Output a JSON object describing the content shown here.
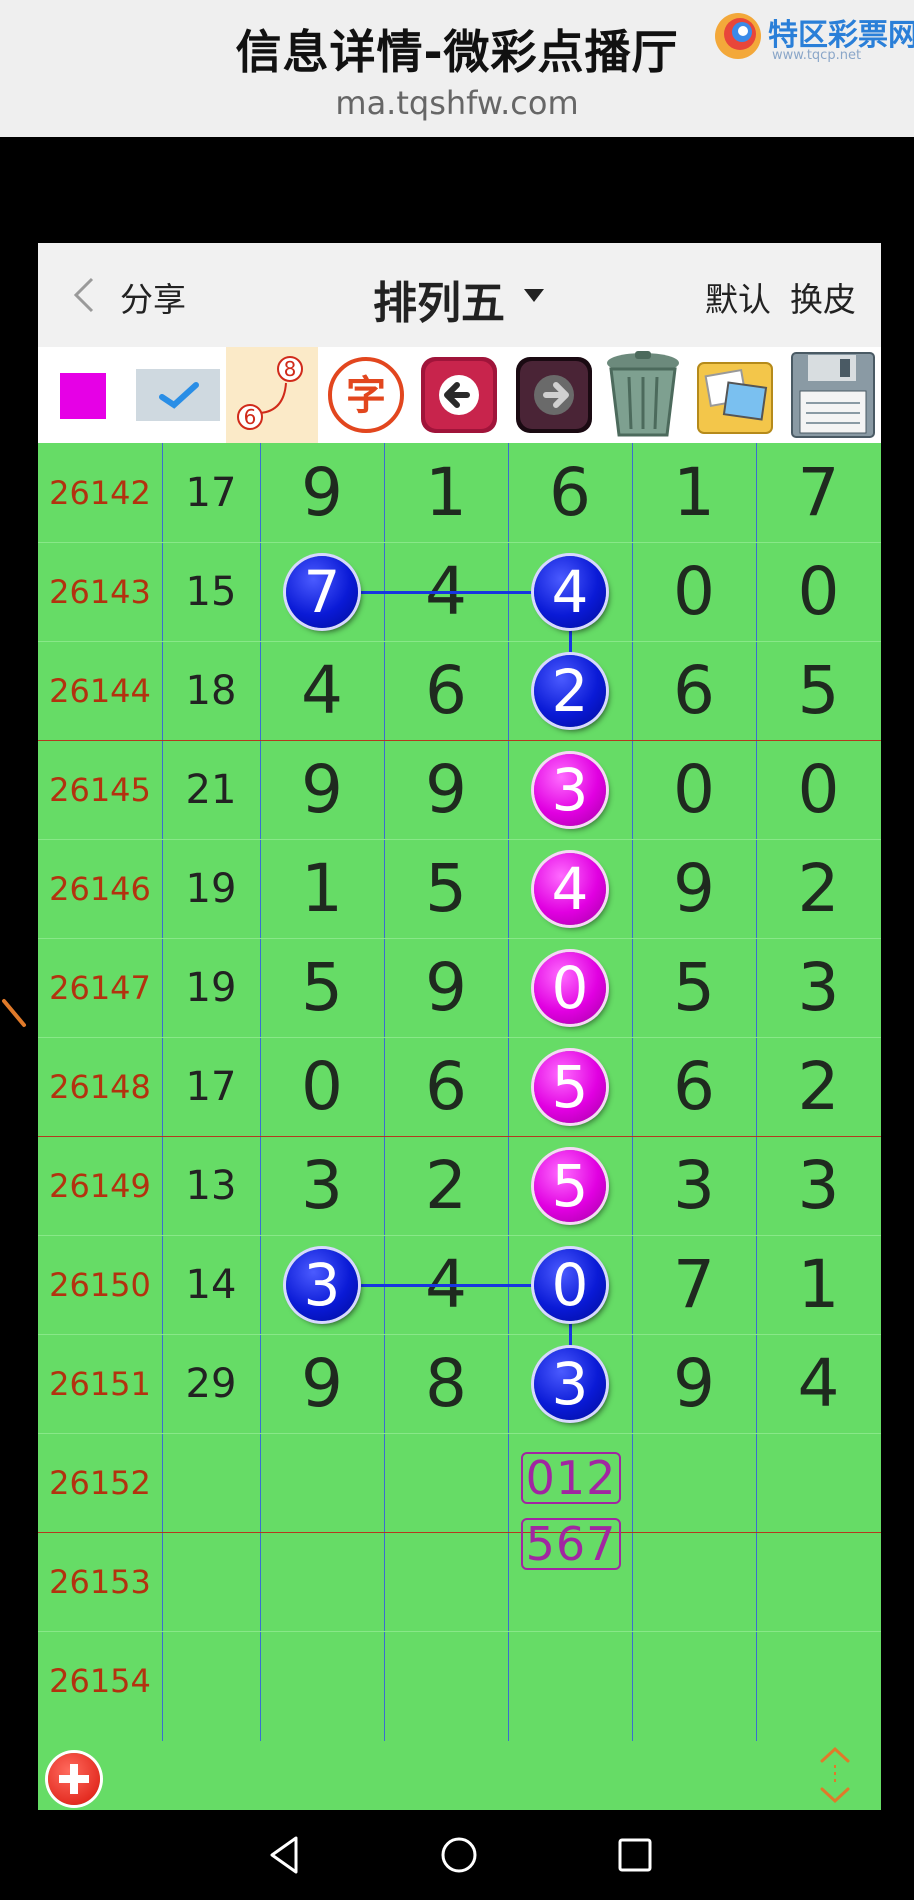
{
  "banner": {
    "title": "信息详情-微彩点播厅",
    "url": "ma.tqshfw.com",
    "logo_text": "特区彩票网",
    "logo_sub": "www.tqcp.net"
  },
  "header": {
    "share_label": "分享",
    "title": "排列五",
    "default_label": "默认",
    "skin_label": "换皮"
  },
  "toolbar": {
    "color_swatch": "#e600e6",
    "icons": [
      "color-swatch-icon",
      "check-icon",
      "line-draw-icon",
      "char-icon",
      "arrow-left-icon",
      "arrow-right-icon",
      "trash-icon",
      "gallery-icon",
      "save-disk-icon"
    ],
    "line_draw_numbers": [
      "8",
      "6"
    ],
    "char_label": "字"
  },
  "rows": [
    {
      "period": "26142",
      "sum": "17",
      "d": [
        "9",
        "1",
        "6",
        "1",
        "7"
      ]
    },
    {
      "period": "26143",
      "sum": "15",
      "d": [
        "7",
        "4",
        "4",
        "0",
        "0"
      ]
    },
    {
      "period": "26144",
      "sum": "18",
      "d": [
        "4",
        "6",
        "2",
        "6",
        "5"
      ]
    },
    {
      "period": "26145",
      "sum": "21",
      "d": [
        "9",
        "9",
        "3",
        "0",
        "0"
      ]
    },
    {
      "period": "26146",
      "sum": "19",
      "d": [
        "1",
        "5",
        "4",
        "9",
        "2"
      ]
    },
    {
      "period": "26147",
      "sum": "19",
      "d": [
        "5",
        "9",
        "0",
        "5",
        "3"
      ]
    },
    {
      "period": "26148",
      "sum": "17",
      "d": [
        "0",
        "6",
        "5",
        "6",
        "2"
      ]
    },
    {
      "period": "26149",
      "sum": "13",
      "d": [
        "3",
        "2",
        "5",
        "3",
        "3"
      ]
    },
    {
      "period": "26150",
      "sum": "14",
      "d": [
        "3",
        "4",
        "0",
        "7",
        "1"
      ]
    },
    {
      "period": "26151",
      "sum": "29",
      "d": [
        "9",
        "8",
        "3",
        "9",
        "4"
      ]
    },
    {
      "period": "26152",
      "sum": "",
      "d": [
        "",
        "",
        "",
        "",
        ""
      ]
    },
    {
      "period": "26153",
      "sum": "",
      "d": [
        "",
        "",
        "",
        "",
        ""
      ]
    },
    {
      "period": "26154",
      "sum": "",
      "d": [
        "",
        "",
        "",
        "",
        ""
      ]
    }
  ],
  "highlights": [
    {
      "row": 1,
      "col": 0,
      "color": "blue"
    },
    {
      "row": 1,
      "col": 2,
      "color": "blue"
    },
    {
      "row": 2,
      "col": 2,
      "color": "blue"
    },
    {
      "row": 3,
      "col": 2,
      "color": "magenta"
    },
    {
      "row": 4,
      "col": 2,
      "color": "magenta"
    },
    {
      "row": 5,
      "col": 2,
      "color": "magenta"
    },
    {
      "row": 6,
      "col": 2,
      "color": "magenta"
    },
    {
      "row": 7,
      "col": 2,
      "color": "magenta"
    },
    {
      "row": 8,
      "col": 0,
      "color": "blue"
    },
    {
      "row": 8,
      "col": 2,
      "color": "blue"
    },
    {
      "row": 9,
      "col": 2,
      "color": "blue"
    }
  ],
  "predictions": [
    "012",
    "567"
  ],
  "colors": {
    "grid_bg": "#66dc66",
    "ball_blue": "#0a1ad6",
    "ball_magenta": "#e100e1",
    "period_text": "#b3320f",
    "prediction": "#a126a1"
  }
}
